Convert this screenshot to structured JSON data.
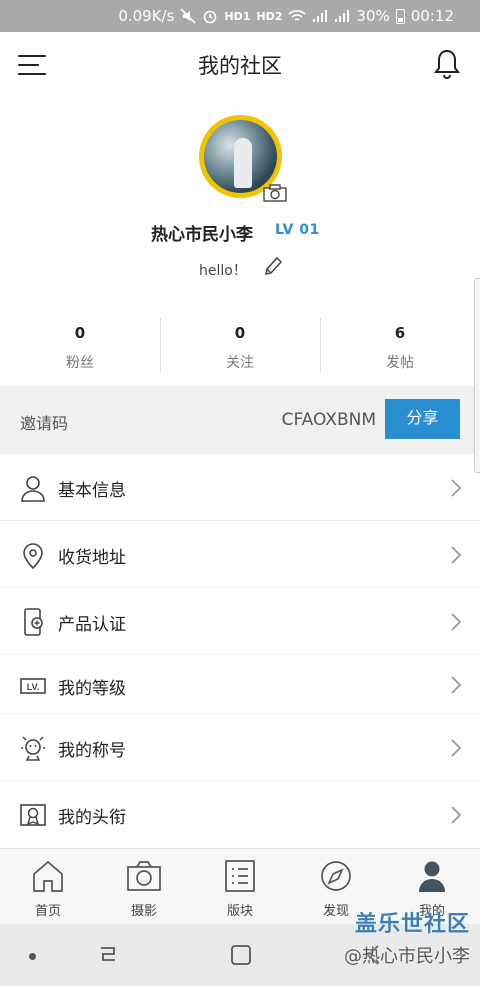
{
  "status_bar": {
    "net_speed": "0.09K/s",
    "hd1": "HD1",
    "hd2": "HD2",
    "battery": "30%",
    "time": "00:12"
  },
  "header": {
    "title": "我的社区"
  },
  "profile": {
    "nickname": "热心市民小李",
    "level": "LV 01",
    "signature": "hello！"
  },
  "stats": [
    {
      "value": "0",
      "label": "粉丝"
    },
    {
      "value": "0",
      "label": "关注"
    },
    {
      "value": "6",
      "label": "发帖"
    }
  ],
  "invite": {
    "label": "邀请码",
    "code": "CFAOXBNM",
    "share_label": "分享"
  },
  "menu": [
    {
      "label": "基本信息",
      "icon": "person-icon"
    },
    {
      "label": "收货地址",
      "icon": "location-pin-icon"
    },
    {
      "label": "产品认证",
      "icon": "phone-certify-icon"
    },
    {
      "label": "我的等级",
      "icon": "level-badge-icon",
      "icon_text": "LV."
    },
    {
      "label": "我的称号",
      "icon": "title-badge-icon"
    },
    {
      "label": "我的头衔",
      "icon": "rank-certificate-icon"
    }
  ],
  "tabs": [
    {
      "label": "首页",
      "icon": "home-icon"
    },
    {
      "label": "摄影",
      "icon": "camera-icon"
    },
    {
      "label": "版块",
      "icon": "board-list-icon"
    },
    {
      "label": "发现",
      "icon": "compass-icon"
    },
    {
      "label": "我的",
      "icon": "user-icon",
      "active": true
    }
  ],
  "watermark": {
    "line1": "盖乐世社区",
    "line2": "@热心市民小李"
  },
  "colors": {
    "accent": "#2a8fd0",
    "avatar_ring": "#f2c300",
    "status_bar": "#a9a9a9"
  }
}
